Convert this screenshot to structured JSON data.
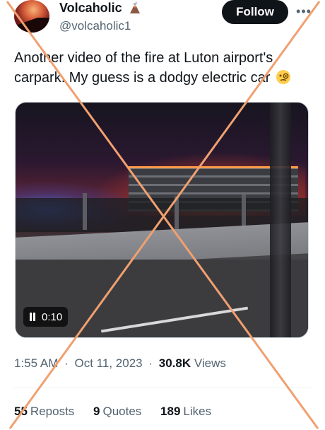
{
  "author": {
    "display_name": "Volcaholic",
    "handle": "@volcaholic1",
    "badge_icon": "volcano-icon"
  },
  "actions": {
    "follow_label": "Follow",
    "more_icon": "more-icon"
  },
  "tweet": {
    "text": "Another video of the fire at Luton airport's carpark. My guess is a dodgy electric car",
    "emoji_icon": "face-with-monocle-icon"
  },
  "video": {
    "elapsed": "0:10",
    "state_icon": "pause-icon"
  },
  "meta": {
    "time": "1:55 AM",
    "date": "Oct 11, 2023",
    "separator": "·",
    "views_count": "30.8K",
    "views_label": "Views"
  },
  "stats": {
    "reposts_count": "55",
    "reposts_label": "Reposts",
    "quotes_count": "9",
    "quotes_label": "Quotes",
    "likes_count": "189",
    "likes_label": "Likes"
  },
  "overlay": {
    "cross_color": "#f0a070"
  }
}
